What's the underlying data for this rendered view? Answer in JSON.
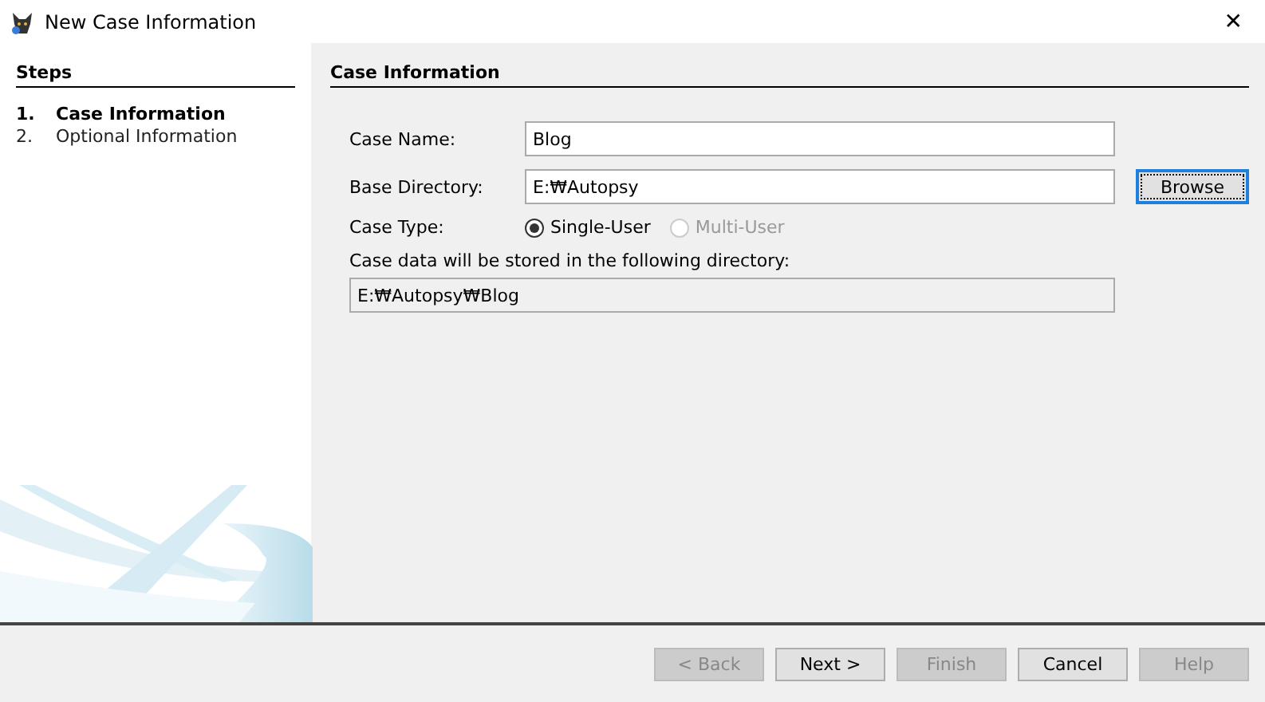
{
  "window": {
    "title": "New Case Information",
    "close": "✕"
  },
  "steps": {
    "title": "Steps",
    "items": [
      {
        "number": "1.",
        "label": "Case Information",
        "selected": true
      },
      {
        "number": "2.",
        "label": "Optional Information",
        "selected": false
      }
    ]
  },
  "panel": {
    "title": "Case Information",
    "case_name": {
      "label": "Case Name:",
      "value": "Blog"
    },
    "base_directory": {
      "label": "Base Directory:",
      "value": "E:₩Autopsy",
      "button": "Browse"
    },
    "case_type": {
      "label": "Case Type:",
      "options": [
        {
          "label": "Single-User",
          "selected": true,
          "disabled": false
        },
        {
          "label": "Multi-User",
          "selected": false,
          "disabled": true
        }
      ]
    },
    "storage_note": "Case data will be stored in the following directory:",
    "storage_path": "E:₩Autopsy₩Blog"
  },
  "buttons": [
    {
      "label": "< Back",
      "disabled": true
    },
    {
      "label": "Next >",
      "disabled": false
    },
    {
      "label": "Finish",
      "disabled": true
    },
    {
      "label": "Cancel",
      "disabled": false
    },
    {
      "label": "Help",
      "disabled": true
    }
  ]
}
